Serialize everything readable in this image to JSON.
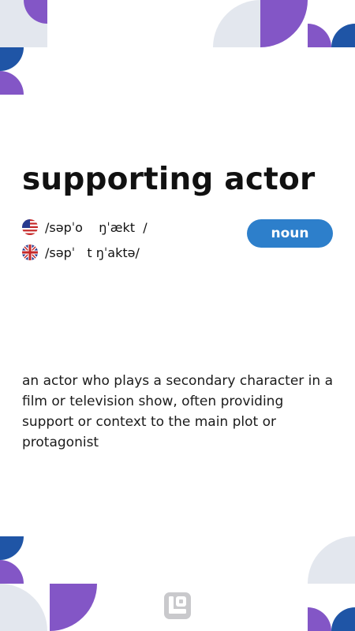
{
  "entry": {
    "word": "supporting actor",
    "pronunciations": [
      {
        "region": "US",
        "flag_icon": "us-flag-icon",
        "ipa": "/səpˈo    ŋˈækt  /"
      },
      {
        "region": "UK",
        "flag_icon": "uk-flag-icon",
        "ipa": "/səpˈ   t ŋˈaktə/"
      }
    ],
    "part_of_speech": "noun",
    "definition": "an actor who plays a secondary character in a film or television show, often providing support or context to the main plot or protagonist"
  },
  "colors": {
    "purple": "#8356c6",
    "blue": "#1f55a6",
    "light_gray": "#e3e7ee",
    "badge": "#2d7fcb"
  }
}
